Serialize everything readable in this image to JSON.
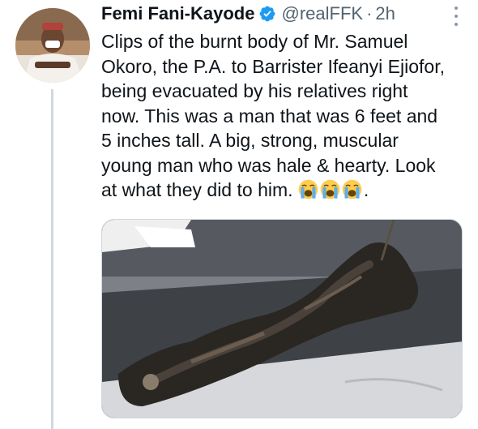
{
  "tweet": {
    "author_name": "Femi Fani-Kayode",
    "handle": "@realFFK",
    "separator": "·",
    "time": "2h",
    "text_lines": [
      "Clips of the burnt body of Mr. Samuel",
      "Okoro, the P.A. to Barrister Ifeanyi Ejiofor,",
      "being evacuated by his relatives right",
      "now. This was a man that was 6 feet and",
      "5 inches tall. A big, strong, muscular",
      "young man who was hale & hearty. Look",
      "at what they did to him."
    ],
    "trailing_text": ".",
    "emojis": [
      "loudly-crying-face-icon",
      "loudly-crying-face-icon",
      "loudly-crying-face-icon"
    ],
    "verified": true,
    "colors": {
      "text": "#0f1419",
      "secondary": "#536471",
      "verified_badge": "#1d9bf0",
      "thread_line": "#cfd9de"
    }
  }
}
